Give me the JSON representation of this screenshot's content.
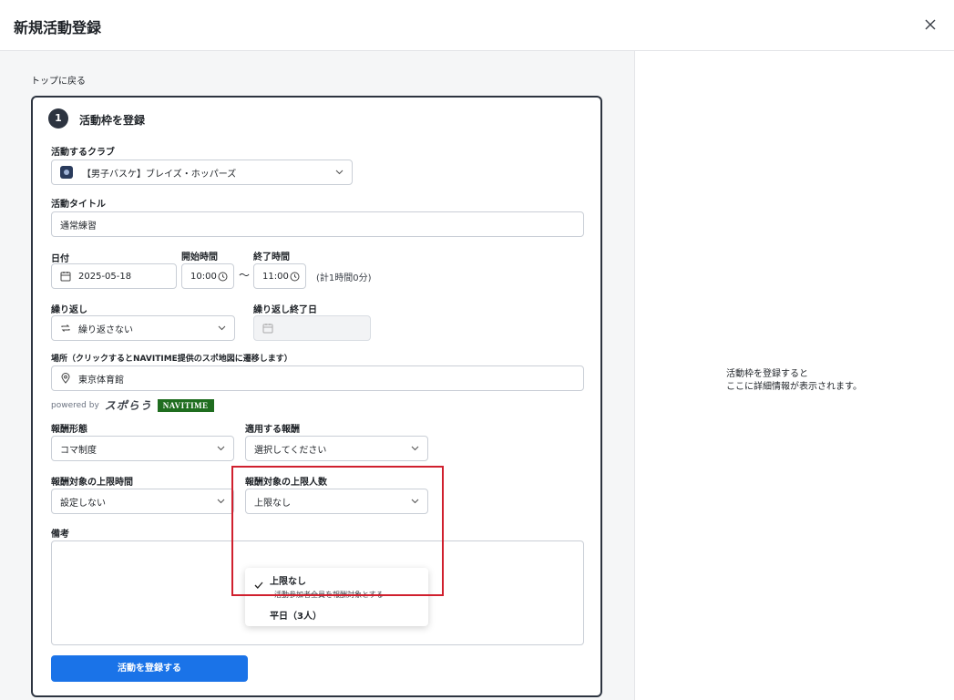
{
  "header": {
    "title": "新規活動登録"
  },
  "back_link": "トップに戻る",
  "step": {
    "number": "1",
    "title": "活動枠を登録"
  },
  "club": {
    "label": "活動するクラブ",
    "value": "【男子バスケ】ブレイズ・ホッパーズ"
  },
  "activity_title": {
    "label": "活動タイトル",
    "value": "通常練習"
  },
  "date": {
    "label": "日付",
    "value": "2025-05-18"
  },
  "start_time": {
    "label": "開始時間",
    "value": "10:00"
  },
  "separator": "〜",
  "end_time": {
    "label": "終了時間",
    "value": "11:00"
  },
  "duration_note": "(計1時間0分)",
  "repeat": {
    "label": "繰り返し",
    "value": "繰り返さない"
  },
  "repeat_end": {
    "label": "繰り返し終了日",
    "value": ""
  },
  "location": {
    "label": "場所（クリックするとNAVITIME提供のスポ地図に遷移します）",
    "value": "東京体育館"
  },
  "powered": {
    "text": "powered by",
    "logo1": "スポらう",
    "logo2": "NAVITIME"
  },
  "pay_type": {
    "label": "報酬形態",
    "value": "コマ制度"
  },
  "pay_apply": {
    "label": "適用する報酬",
    "value": "選択してください"
  },
  "pay_hours": {
    "label": "報酬対象の上限時間",
    "value": "設定しない"
  },
  "pay_people": {
    "label": "報酬対象の上限人数",
    "value": "上限なし"
  },
  "dropdown": {
    "options": [
      {
        "title": "上限なし",
        "desc": "活動参加者全員を報酬対象とする",
        "selected": true
      },
      {
        "title": "平日（3人）"
      }
    ]
  },
  "memo": {
    "label": "備考"
  },
  "submit_label": "活動を登録する",
  "right_hint": "活動枠を登録すると\nここに詳細情報が表示されます。",
  "colors": {
    "primary": "#1a73e8",
    "highlight": "#d0202e",
    "dark": "#2d3440"
  }
}
